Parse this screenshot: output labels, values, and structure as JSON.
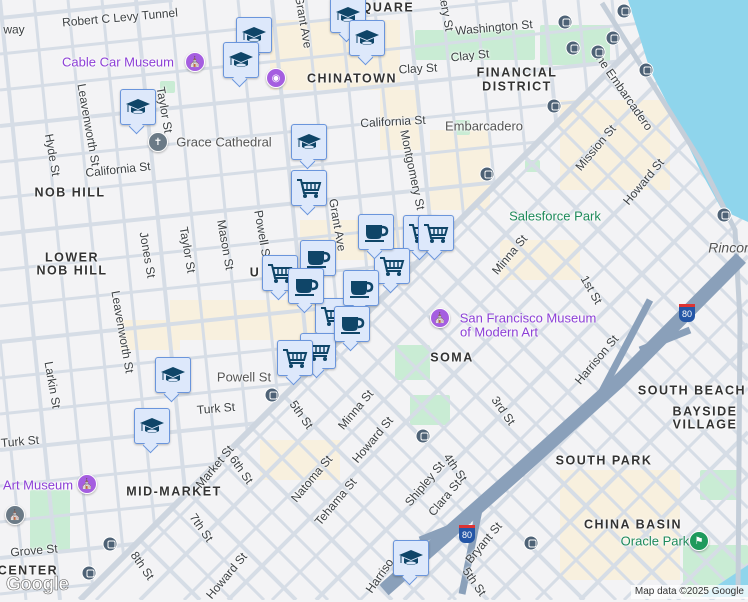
{
  "map": {
    "districts": [
      "CHINATOWN",
      "FINANCIAL",
      "DISTRICT",
      "NOB HILL",
      "LOWER",
      "NOB HILL",
      "SOMA",
      "SOUTH BEACH",
      "BAYSIDE",
      "VILLAGE",
      "SOUTH PARK",
      "CHINA BASIN",
      "MID-MARKET",
      "CENTER",
      "SQUARE"
    ],
    "streets": [
      "Robert C Levy Tunnel",
      "way",
      "California St",
      "California St",
      "Hyde St",
      "Leavenworth St",
      "Taylor St",
      "Taylor St",
      "Jones St",
      "Mason St",
      "Powell St",
      "Grant Ave",
      "Grant Ave",
      "Clay St",
      "Clay St",
      "Washington St",
      "Montgomery St",
      "The Embarcadero",
      "Mission St",
      "Howard St",
      "Minna St",
      "1st St",
      "Harrison St",
      "3rd St",
      "4th St",
      "Shipley St",
      "Clara St",
      "Bryant St",
      "5th St",
      "Harriso",
      "Larkin St",
      "Leavenworth St",
      "Turk St",
      "Turk St",
      "Market St",
      "6th St",
      "5th St",
      "Minna St",
      "Howard St",
      "Natoma St",
      "Tehama St",
      "7th St",
      "Grove St",
      "8th St",
      "Howard St",
      "U",
      "tery St"
    ],
    "places": {
      "cable_car_museum": "Cable Car Museum",
      "grace_cathedral": "Grace Cathedral",
      "embarcadero_station": "Embarcadero",
      "salesforce_park": "Salesforce Park",
      "rincon": "Rincon",
      "sfmoma_line1": "San Francisco Museum",
      "sfmoma_line2": "of Modern Art",
      "oracle_park": "Oracle Park",
      "art_museum": "Art Museum",
      "powell_station": "Powell St"
    },
    "highway_shield": "80",
    "markers": [
      "school",
      "school",
      "school",
      "school",
      "school",
      "school",
      "school",
      "school",
      "school",
      "cart",
      "cart",
      "cart",
      "cart",
      "cart",
      "cart",
      "cart",
      "cart",
      "coffee",
      "coffee",
      "coffee",
      "coffee",
      "coffee"
    ],
    "attribution": "Map data ©2025 Google",
    "logo": "Google"
  },
  "colors": {
    "water": "#8fd5ec",
    "park": "#c9ecd4",
    "commercial": "#f8f0de",
    "road": "#d6dde6",
    "freeway": "#8aa0ba",
    "marker_fill": "#dde8fb",
    "marker_border": "#6a95dc",
    "marker_icon": "#0f4568"
  }
}
